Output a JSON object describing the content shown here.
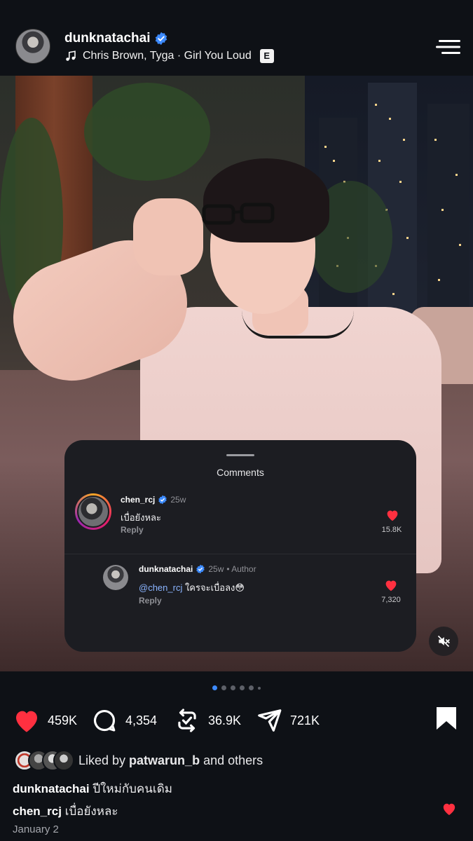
{
  "header": {
    "username": "dunknatachai",
    "music": "Chris Brown, Tyga · Girl You Loud",
    "explicit_badge": "E"
  },
  "comments": {
    "title": "Comments",
    "items": [
      {
        "user": "chen_rcj",
        "time": "25w",
        "text": "เบื่อยังหละ",
        "reply": "Reply",
        "likes": "15.8K"
      },
      {
        "user": "dunknatachai",
        "time": "25w",
        "author_tag": "• Author",
        "mention": "@chen_rcj",
        "text": " ใครจะเบื่อลง😳",
        "reply": "Reply",
        "likes": "7,320"
      }
    ]
  },
  "pagination": {
    "total_dots": 6,
    "active_index": 0
  },
  "actions": {
    "likes": "459K",
    "comments": "4,354",
    "reposts": "36.9K",
    "shares": "721K"
  },
  "liked_by": {
    "prefix": "Liked by ",
    "user": "patwarun_b",
    "suffix": " and others"
  },
  "captions": [
    {
      "user": "dunknatachai",
      "text": " ปีใหม่กับคนเดิม"
    },
    {
      "user": "chen_rcj",
      "text": " เบื่อยังหละ"
    }
  ],
  "date": "January 2",
  "colors": {
    "background": "#0e1116",
    "like_red": "#ff3040",
    "verified_blue": "#3d8bff",
    "mention_blue": "#8ab4ff"
  },
  "icons": [
    "verified-icon",
    "music-note-icon",
    "menu-icon",
    "mute-icon",
    "heart-icon",
    "comment-icon",
    "repost-icon",
    "share-icon",
    "bookmark-icon"
  ]
}
